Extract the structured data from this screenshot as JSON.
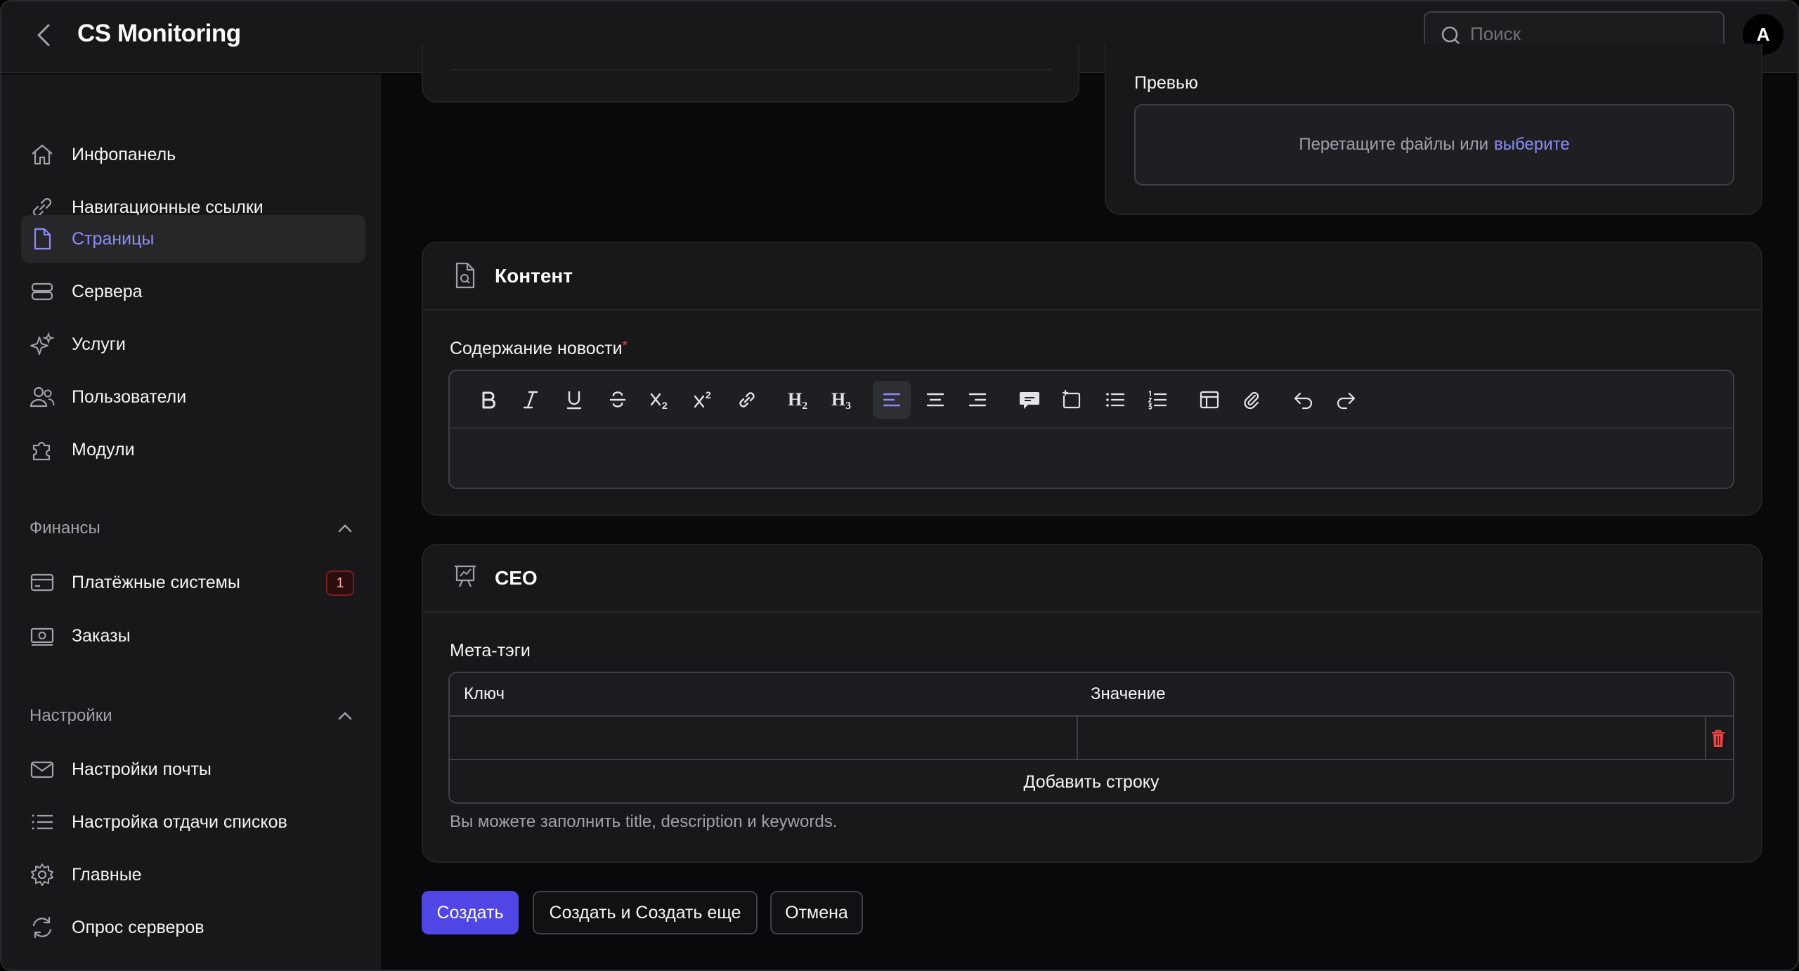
{
  "app": {
    "title": "CS Monitoring"
  },
  "header": {
    "search_placeholder": "Поиск",
    "avatar_initial": "A"
  },
  "sidebar": {
    "items": [
      {
        "label": "Инфопанель",
        "icon": "home-icon"
      },
      {
        "label": "Навигационные ссылки",
        "icon": "link-icon"
      },
      {
        "label": "Страницы",
        "icon": "document-icon",
        "active": true
      },
      {
        "label": "Сервера",
        "icon": "server-icon"
      },
      {
        "label": "Услуги",
        "icon": "sparkles-icon"
      },
      {
        "label": "Пользователи",
        "icon": "users-icon"
      },
      {
        "label": "Модули",
        "icon": "puzzle-icon"
      }
    ],
    "groups": [
      {
        "title": "Финансы",
        "items": [
          {
            "label": "Платёжные системы",
            "icon": "credit-card-icon",
            "badge": "1"
          },
          {
            "label": "Заказы",
            "icon": "banknotes-icon"
          }
        ]
      },
      {
        "title": "Настройки",
        "items": [
          {
            "label": "Настройки почты",
            "icon": "envelope-icon"
          },
          {
            "label": "Настройка отдачи списков",
            "icon": "list-icon"
          },
          {
            "label": "Главные",
            "icon": "cog-icon"
          },
          {
            "label": "Опрос серверов",
            "icon": "refresh-icon"
          }
        ]
      }
    ]
  },
  "preview": {
    "label": "Превью",
    "drop_text": "Перетащите файлы или",
    "drop_link": "выберите"
  },
  "content_section": {
    "title": "Контент",
    "field_label": "Содержание новости",
    "required_mark": "*",
    "toolbar": [
      "bold-icon",
      "italic-icon",
      "underline-icon",
      "strikethrough-icon",
      "subscript-icon",
      "superscript-icon",
      "link-icon",
      "h2",
      "h3",
      "align-left-icon",
      "align-center-icon",
      "align-right-icon",
      "blockquote-icon",
      "code-block-icon",
      "bullet-list-icon",
      "ordered-list-icon",
      "table-icon",
      "attach-icon",
      "undo-icon",
      "redo-icon"
    ],
    "h2_label": "H₂",
    "h3_label": "H₃"
  },
  "seo_section": {
    "title": "СЕО",
    "meta_label": "Мета-тэги",
    "columns": [
      "Ключ",
      "Значение"
    ],
    "rows": [
      {
        "key": "",
        "value": ""
      }
    ],
    "add_row": "Добавить строку",
    "hint": "Вы можете заполнить title, description и keywords."
  },
  "actions": {
    "create": "Создать",
    "create_another": "Создать и Создать еще",
    "cancel": "Отмена"
  },
  "colors": {
    "accent": "#8b8cf6",
    "primary_button": "#4f46e5",
    "danger": "#ef4444"
  }
}
